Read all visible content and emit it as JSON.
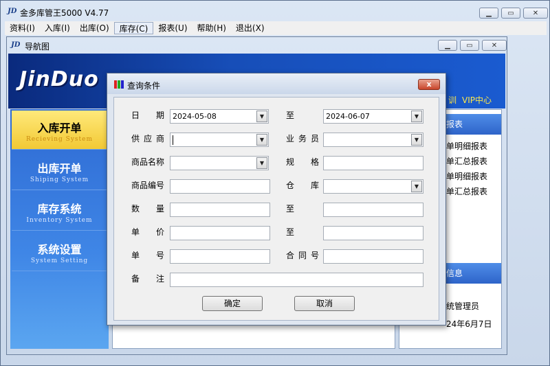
{
  "app": {
    "logo": "JD",
    "title": "金多库管王5000 V4.77"
  },
  "menu": [
    "资料(I)",
    "入库(I)",
    "出库(O)",
    "库存(C)",
    "报表(U)",
    "帮助(H)",
    "退出(X)"
  ],
  "nav": {
    "logo": "JD",
    "title": "导航图",
    "brand": "JinDuo",
    "links": [
      "训",
      "VIP中心"
    ],
    "modules": [
      {
        "cn": "入库开单",
        "en": "Recieving System"
      },
      {
        "cn": "出库开单",
        "en": "Shiping System"
      },
      {
        "cn": "库存系统",
        "en": "Inventory System"
      },
      {
        "cn": "系统设置",
        "en": "System Setting"
      }
    ],
    "right_panel": {
      "reports_header": "报表",
      "report_links": [
        "单明细报表",
        "单汇总报表",
        "单明细报表",
        "单汇总报表"
      ],
      "info_header": "信息",
      "user": "统管理员",
      "date": "24年6月7日"
    }
  },
  "dialog": {
    "title": "查询条件",
    "close": "x",
    "labels": {
      "date": [
        "日",
        "期"
      ],
      "to1": "至",
      "supplier": [
        "供",
        "应",
        "商"
      ],
      "salesperson": [
        "业",
        "务",
        "员"
      ],
      "product_name": "商品名称",
      "spec": [
        "规",
        "格"
      ],
      "product_code": "商品编号",
      "warehouse": [
        "仓",
        "库"
      ],
      "quantity": [
        "数",
        "量"
      ],
      "to2": "至",
      "price": [
        "单",
        "价"
      ],
      "to3": "至",
      "order_no": [
        "单",
        "号"
      ],
      "contract_no": [
        "合",
        "同",
        "号"
      ],
      "remark": [
        "备",
        "注"
      ]
    },
    "values": {
      "date_from": "2024-05-08",
      "date_to": "2024-06-07",
      "supplier": "",
      "salesperson": "",
      "product_name": "",
      "spec": "",
      "product_code": "",
      "warehouse": "",
      "qty_from": "",
      "qty_to": "",
      "price_from": "",
      "price_to": "",
      "order_no": "",
      "contract_no": "",
      "remark": ""
    },
    "ok": "确定",
    "cancel": "取消"
  }
}
